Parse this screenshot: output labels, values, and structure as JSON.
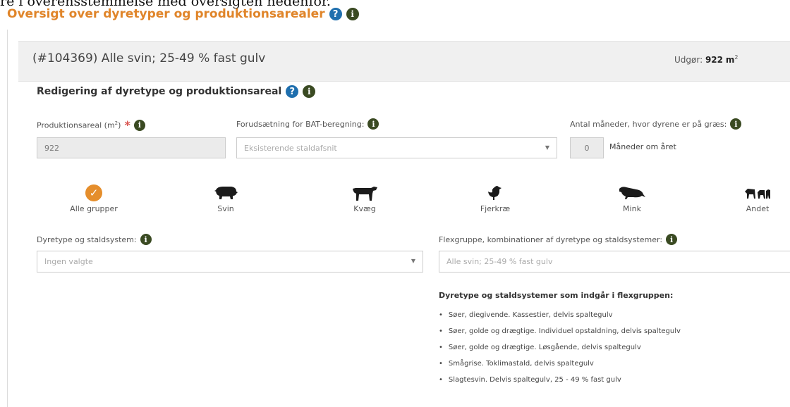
{
  "top_clipped_text": "re i overensstemmelse med oversigten nedenfor.",
  "heading": {
    "title": "Oversigt over dyretyper og produktionsarealer"
  },
  "panel": {
    "title": "(#104369) Alle svin; 25-49 % fast gulv",
    "area_label": "Udgør:",
    "area_value": "922",
    "area_unit": "m",
    "area_sup": "2"
  },
  "editing": {
    "title": "Redigering af dyretype og produktionsareal",
    "production_area_label": "Produktionsareal (m",
    "production_area_sup": "2",
    "production_area_label_end": ")",
    "required_mark": "*",
    "production_area_value": "922",
    "bat_label": "Forudsætning for BAT-beregning:",
    "bat_value": "Eksisterende staldafsnit",
    "months_label": "Antal måneder, hvor dyrene er på græs:",
    "months_value": "0",
    "months_unit": "Måneder om året"
  },
  "animal_groups": [
    {
      "label": "Alle grupper",
      "icon": "check-icon",
      "selected": true
    },
    {
      "label": "Svin",
      "icon": "pig-icon"
    },
    {
      "label": "Kvæg",
      "icon": "cow-icon"
    },
    {
      "label": "Fjerkræ",
      "icon": "chicken-icon"
    },
    {
      "label": "Mink",
      "icon": "mink-icon"
    },
    {
      "label": "Andet",
      "icon": "other-animals-icon"
    }
  ],
  "animal_type": {
    "label": "Dyretype og staldsystem:",
    "placeholder": "Ingen valgte"
  },
  "flexgroup": {
    "label": "Flexgruppe, kombinationer af dyretype og staldsystemer:",
    "value": "Alle svin; 25-49 % fast gulv",
    "list_title": "Dyretype og staldsystemer som indgår i flexgruppen:",
    "items": [
      "Søer, diegivende. Kassestier, delvis spaltegulv",
      "Søer, golde og drægtige. Individuel opstaldning, delvis spaltegulv",
      "Søer, golde og drægtige. Løsgående, delvis spaltegulv",
      "Smågrise. Toklimastald, delvis spaltegulv",
      "Slagtesvin. Delvis spaltegulv, 25 - 49 % fast gulv"
    ]
  },
  "colors": {
    "heading": "#e0852a",
    "help_icon": "#1f6fae",
    "info_icon": "#3a4a22",
    "selected_group": "#e58e2c",
    "required": "#d9534f"
  }
}
